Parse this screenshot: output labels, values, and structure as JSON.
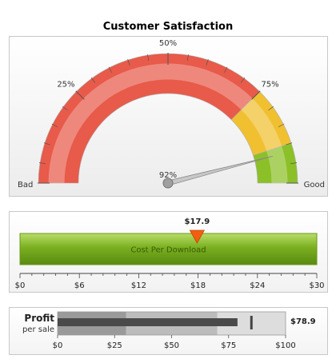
{
  "chart_data": [
    {
      "type": "angular-gauge",
      "title": "Customer Satisfaction",
      "range": [
        0,
        100
      ],
      "value": 92,
      "value_label": "92%",
      "bands": [
        {
          "from": 0,
          "to": 75,
          "color": "#e85a4a"
        },
        {
          "from": 75,
          "to": 90,
          "color": "#f0c030"
        },
        {
          "from": 90,
          "to": 100,
          "color": "#8cc028"
        }
      ],
      "tick_labels": [
        {
          "value": 25,
          "label": "25%"
        },
        {
          "value": 50,
          "label": "50%"
        },
        {
          "value": 75,
          "label": "75%"
        }
      ],
      "min_label": "Bad",
      "max_label": "Good"
    },
    {
      "type": "linear-gauge",
      "range": [
        0,
        30
      ],
      "value": 17.9,
      "value_label": "$17.9",
      "band_label": "Cost Per Download",
      "band_color": "#7ab020",
      "pointer_color": "#f06010",
      "tick_labels": [
        "$0",
        "$6",
        "$12",
        "$18",
        "$24",
        "$30"
      ]
    },
    {
      "type": "bullet",
      "title": "Profit",
      "subtitle": "per sale",
      "range": [
        0,
        100
      ],
      "value": 78.9,
      "value_label": "$78.9",
      "target": 85,
      "bands": [
        {
          "from": 0,
          "to": 30,
          "color": "#9a9a9a"
        },
        {
          "from": 30,
          "to": 70,
          "color": "#bcbcbc"
        },
        {
          "from": 70,
          "to": 100,
          "color": "#dddddd"
        }
      ],
      "tick_labels": [
        "$0",
        "$25",
        "$50",
        "$75",
        "$100"
      ]
    }
  ]
}
